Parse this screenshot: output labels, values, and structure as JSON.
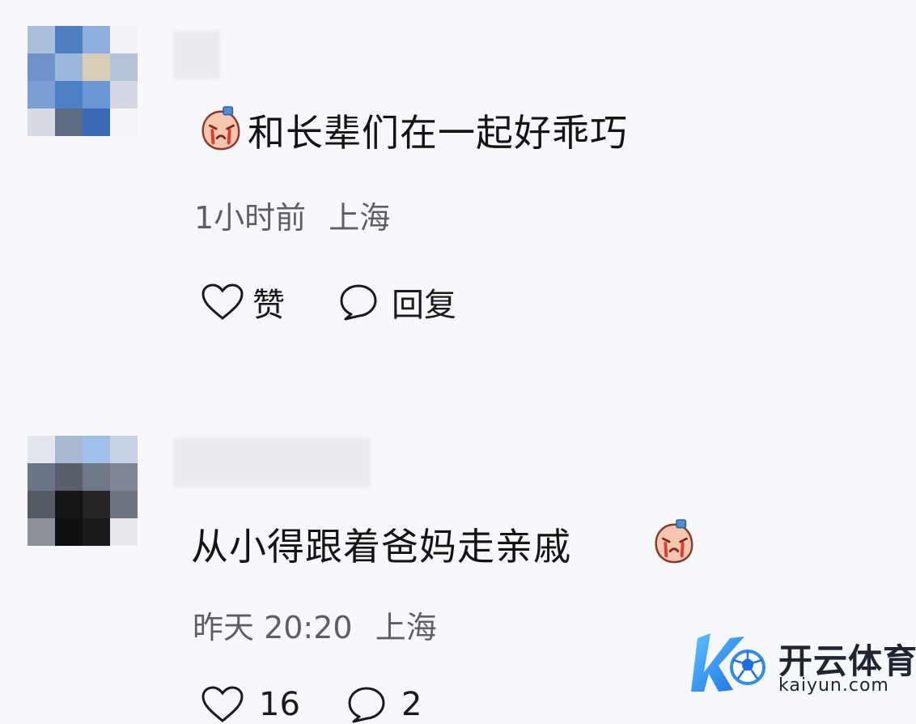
{
  "comments": [
    {
      "text": "和长辈们在一起好乖巧",
      "emoji_name": "crying-face-emoji",
      "time": "1小时前",
      "location": "上海",
      "like_label": "赞",
      "reply_label": "回复"
    },
    {
      "text": "从小得跟着爸妈走亲戚",
      "emoji_name": "crying-face-emoji",
      "time": "昨天 20:20",
      "location": "上海",
      "like_count": "16",
      "reply_count": "2"
    }
  ],
  "watermark": {
    "name": "开云体育",
    "domain": "kaiyun.com"
  },
  "colors": {
    "background": "#f7f8fc",
    "text": "#141414",
    "meta_text": "#5e5f63",
    "watermark_blue": "#2f8df0"
  }
}
